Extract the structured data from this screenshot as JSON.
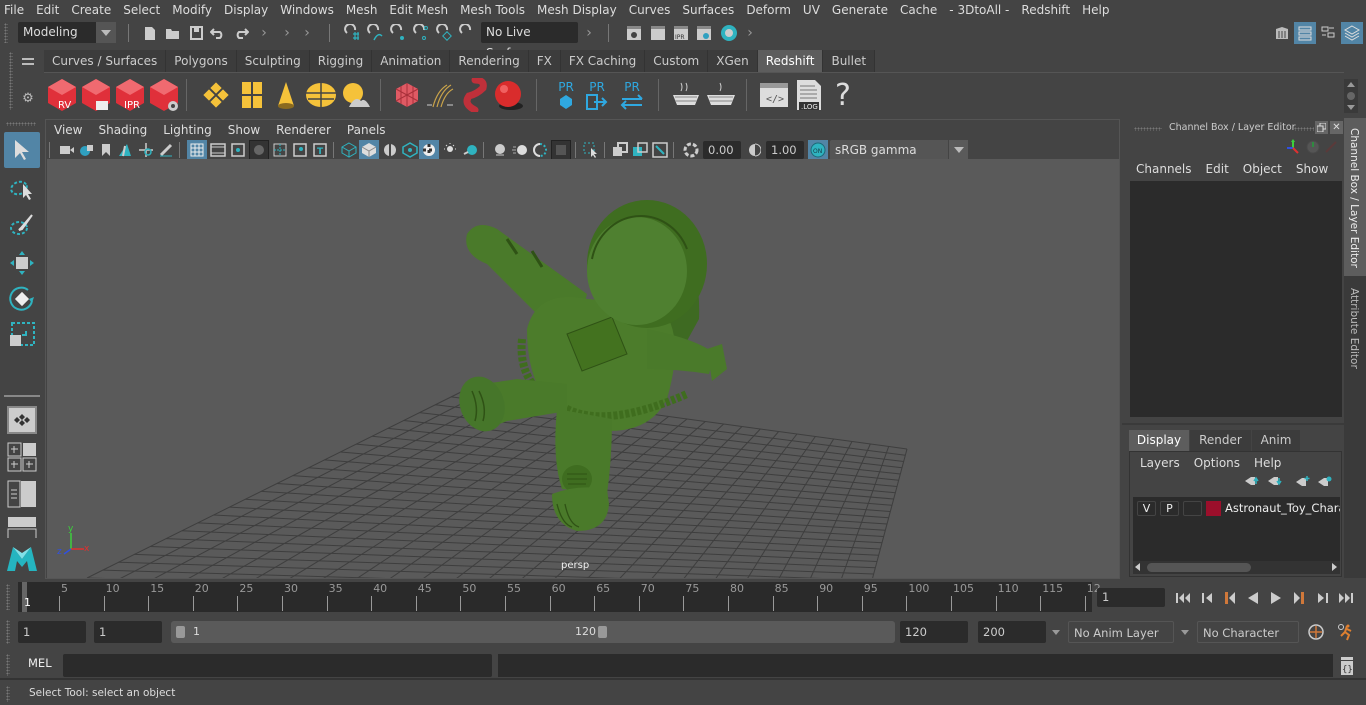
{
  "menubar": {
    "items": [
      "File",
      "Edit",
      "Create",
      "Select",
      "Modify",
      "Display",
      "Windows",
      "Mesh",
      "Edit Mesh",
      "Mesh Tools",
      "Mesh Display",
      "Curves",
      "Surfaces",
      "Deform",
      "UV",
      "Generate",
      "Cache",
      "- 3DtoAll -",
      "Redshift",
      "Help"
    ]
  },
  "statusline": {
    "mode": "Modeling",
    "live_surface": "No Live Surface"
  },
  "shelf": {
    "tabs": [
      "Curves / Surfaces",
      "Polygons",
      "Sculpting",
      "Rigging",
      "Animation",
      "Rendering",
      "FX",
      "FX Caching",
      "Custom",
      "XGen",
      "Redshift",
      "Bullet"
    ],
    "active_tab": "Redshift",
    "icons": [
      {
        "name": "redshift-render-view-icon",
        "label": "RV"
      },
      {
        "name": "redshift-batch-render-icon",
        "label": ""
      },
      {
        "name": "redshift-ipr-icon",
        "label": "IPR"
      },
      {
        "name": "redshift-render-settings-icon",
        "label": ""
      },
      {
        "name": "redshift-area-light-icon",
        "label": ""
      },
      {
        "name": "redshift-portal-light-icon",
        "label": ""
      },
      {
        "name": "redshift-ies-light-icon",
        "label": ""
      },
      {
        "name": "redshift-dome-light-icon",
        "label": ""
      },
      {
        "name": "redshift-sun-sky-icon",
        "label": ""
      },
      {
        "name": "redshift-proxy-icon",
        "label": ""
      },
      {
        "name": "redshift-hair-icon",
        "label": ""
      },
      {
        "name": "redshift-volume-icon",
        "label": ""
      },
      {
        "name": "redshift-sphere-icon",
        "label": ""
      },
      {
        "name": "redshift-pr-export-icon",
        "label": "PR"
      },
      {
        "name": "redshift-pr-import-icon",
        "label": "PR"
      },
      {
        "name": "redshift-pr-swap-icon",
        "label": "PR"
      },
      {
        "name": "redshift-bake-set-icon",
        "label": ""
      },
      {
        "name": "redshift-bake-icon",
        "label": ""
      },
      {
        "name": "redshift-script-icon",
        "label": ""
      },
      {
        "name": "redshift-log-icon",
        "label": ".LOG"
      },
      {
        "name": "redshift-help-icon",
        "label": "?"
      }
    ]
  },
  "viewport": {
    "menus": [
      "View",
      "Shading",
      "Lighting",
      "Show",
      "Renderer",
      "Panels"
    ],
    "exposure": "0.00",
    "gamma": "1.00",
    "color_space": "sRGB gamma",
    "color_mgmt_label": "ON",
    "camera_label": "persp",
    "axis_labels": {
      "x": "x",
      "y": "y",
      "z": "z"
    },
    "model_color": "#4a7a2a"
  },
  "channelbox": {
    "title": "Channel Box / Layer Editor",
    "menus": [
      "Channels",
      "Edit",
      "Object",
      "Show"
    ],
    "layer_tabs": [
      "Display",
      "Render",
      "Anim"
    ],
    "active_layer_tab": "Display",
    "layer_menus": [
      "Layers",
      "Options",
      "Help"
    ],
    "layers": [
      {
        "v": "V",
        "p": "P",
        "color": "#9b0f2b",
        "name": "Astronaut_Toy_Charac"
      }
    ]
  },
  "sidetabs": [
    "Channel Box / Layer Editor",
    "Attribute Editor"
  ],
  "timeline": {
    "ticks": [
      "5",
      "10",
      "15",
      "20",
      "25",
      "30",
      "35",
      "40",
      "45",
      "50",
      "55",
      "60",
      "65",
      "70",
      "75",
      "80",
      "85",
      "90",
      "95",
      "100",
      "105",
      "110",
      "115",
      "12"
    ],
    "current_marker": "1",
    "current_frame": "1"
  },
  "range": {
    "start": "1",
    "playback_start": "1",
    "slider_start": "1",
    "slider_end": "120",
    "playback_end": "120",
    "end": "200",
    "anim_layer": "No Anim Layer",
    "character_set": "No Character Set"
  },
  "cmdline": {
    "label": "MEL"
  },
  "helpline": {
    "text": "Select Tool: select an object"
  }
}
